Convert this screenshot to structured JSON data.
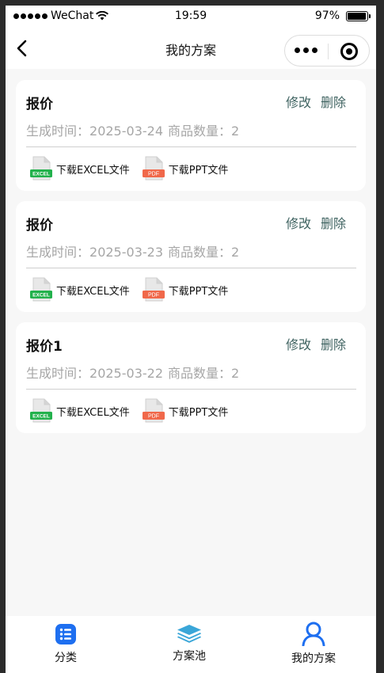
{
  "status_bar": {
    "carrier": "WeChat",
    "time": "19:59",
    "battery": "97%",
    "battery_level": 0.97
  },
  "nav": {
    "title": "我的方案"
  },
  "plans": [
    {
      "title": "报价",
      "edit_label": "修改",
      "delete_label": "删除",
      "time_label": "生成时间：",
      "date": "2025-03-24",
      "count_label": "商品数量：",
      "count": "2",
      "excel_label": "下载EXCEL文件",
      "ppt_label": "下载PPT文件"
    },
    {
      "title": "报价",
      "edit_label": "修改",
      "delete_label": "删除",
      "time_label": "生成时间：",
      "date": "2025-03-23",
      "count_label": "商品数量：",
      "count": "2",
      "excel_label": "下载EXCEL文件",
      "ppt_label": "下载PPT文件"
    },
    {
      "title": "报价1",
      "edit_label": "修改",
      "delete_label": "删除",
      "time_label": "生成时间：",
      "date": "2025-03-22",
      "count_label": "商品数量：",
      "count": "2",
      "excel_label": "下载EXCEL文件",
      "ppt_label": "下载PPT文件"
    }
  ],
  "file_icons": {
    "excel_text": "EXCEL",
    "pdf_text": "PDF"
  },
  "tabs": [
    {
      "label": "分类",
      "icon": "list-icon"
    },
    {
      "label": "方案池",
      "icon": "layers-icon"
    },
    {
      "label": "我的方案",
      "icon": "user-icon"
    }
  ],
  "colors": {
    "action": "#3f6361",
    "meta": "#a6a6a6",
    "excel_green": "#22b14c",
    "pdf_orange": "#f0684a",
    "tab_blue": "#1e6ff0",
    "layers_teal": "#3aa6d8"
  }
}
